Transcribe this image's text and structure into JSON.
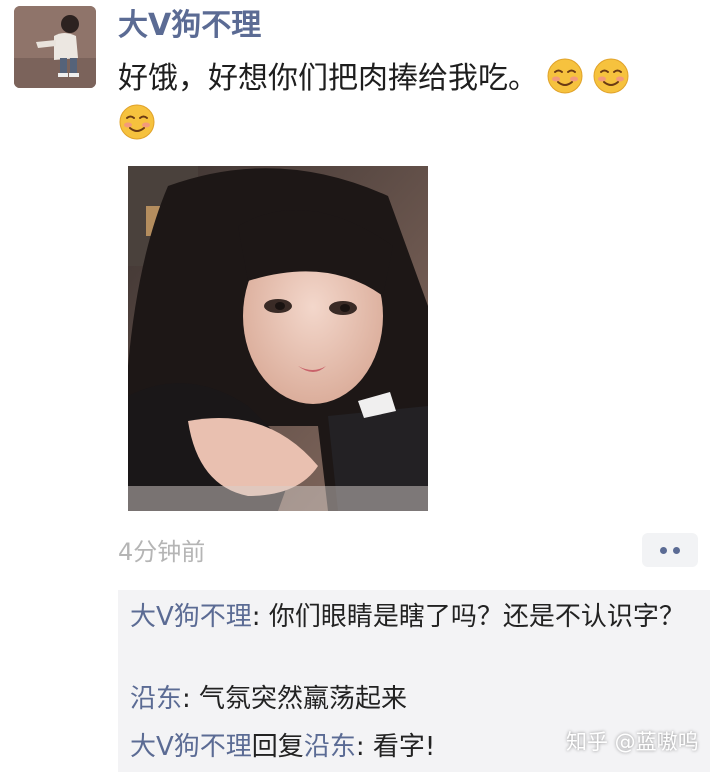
{
  "post": {
    "username": "大V狗不理",
    "text": "好饿，好想你们把肉捧给我吃。",
    "emoji_icon": "smiling-face-emoji-icon",
    "emoji_count": 3,
    "time": "4分钟前",
    "more_icon": "more-dots-icon"
  },
  "comments": [
    {
      "author": "大V狗不理",
      "separator": ": ",
      "text": "你们眼睛是瞎了吗？还是不认识字？"
    },
    {
      "author": "沿东",
      "separator": ": ",
      "text": "气氛突然羸荡起来"
    },
    {
      "author": "大V狗不理",
      "reply_word": "回复",
      "reply_to": "沿东",
      "separator": ": ",
      "text": "看字!"
    }
  ],
  "watermark": "知乎 @蓝嗷呜",
  "colors": {
    "name_blue": "#5b6b94",
    "time_gray": "#b5b5b5",
    "comment_bg": "#f3f3f5"
  }
}
